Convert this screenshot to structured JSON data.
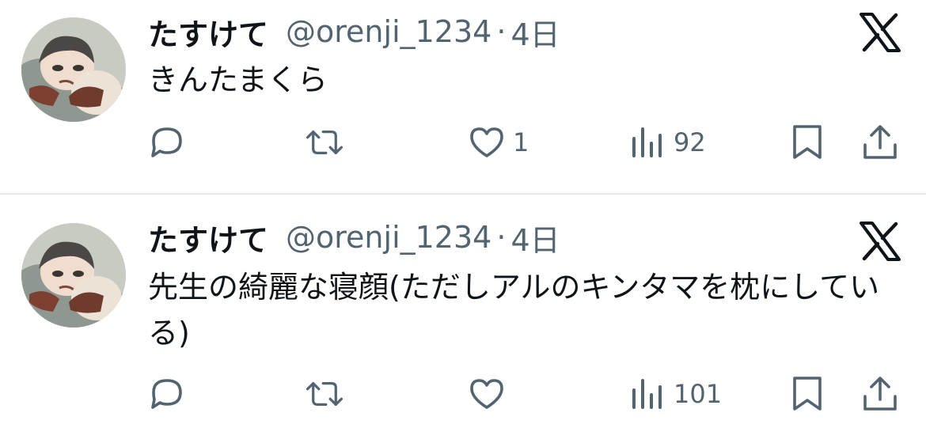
{
  "tweets": [
    {
      "display_name": "たすけて",
      "handle": "@orenji_1234",
      "separator": "·",
      "time": "4日",
      "text": "きんたまくら",
      "likes": "1",
      "views": "92"
    },
    {
      "display_name": "たすけて",
      "handle": "@orenji_1234",
      "separator": "·",
      "time": "4日",
      "text": "先生の綺麗な寝顔(ただしアルのキンタマを枕にしている)",
      "likes": "",
      "views": "101"
    }
  ],
  "icons": {
    "reply": "reply-icon",
    "retweet": "retweet-icon",
    "like": "heart-icon",
    "views": "views-icon",
    "bookmark": "bookmark-icon",
    "share": "share-icon",
    "platform": "x-logo-icon"
  },
  "colors": {
    "text": "#0f1419",
    "secondary": "#536471",
    "divider": "#e7e9ea"
  }
}
